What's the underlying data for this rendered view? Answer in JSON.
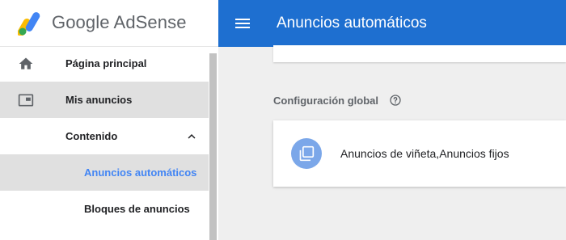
{
  "brand": {
    "name": "Google AdSense",
    "logo_icon": "adsense-logo"
  },
  "sidebar": {
    "items": [
      {
        "label": "Página principal",
        "icon": "home-icon"
      },
      {
        "label": "Mis anuncios",
        "icon": "ads-icon",
        "selected": true
      },
      {
        "label": "Contenido",
        "icon": "chevron-up-icon",
        "expanded": true
      },
      {
        "label": "Anuncios automáticos",
        "active": true
      },
      {
        "label": "Bloques de anuncios"
      }
    ]
  },
  "topbar": {
    "title": "Anuncios automáticos",
    "menu_icon": "menu-icon"
  },
  "main": {
    "section_title": "Configuración global",
    "help_icon": "help-circle-icon",
    "card": {
      "text": "Anuncios de viñeta,Anuncios fijos",
      "icon": "copy-icon"
    }
  },
  "colors": {
    "topbar": "#1e6fd0",
    "active_link": "#4285f4",
    "selected_bg": "#e0e0e0",
    "card_icon_bg": "#7ba7e9",
    "page_bg": "#efefef"
  }
}
